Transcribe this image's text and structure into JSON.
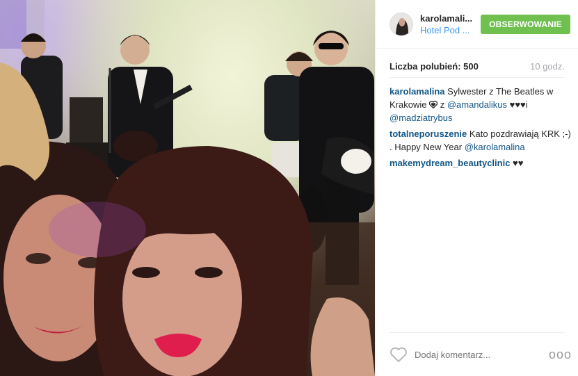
{
  "header": {
    "username": "karolamali...",
    "location": "Hotel Pod ...",
    "follow_label": "OBSERWOWANIE"
  },
  "stats": {
    "likes": "Liczba polubień: 500",
    "time": "10 godz."
  },
  "comments": [
    {
      "user": "karolamalina",
      "text_1": " Sylwester z The Beatles w Krakowie ",
      "text_2": " z ",
      "mention_1": "@amandalikus",
      "text_3": " ♥♥♥i ",
      "mention_2": "@madziatrybus"
    },
    {
      "user": "totalneporuszenie",
      "text_1": " Kato pozdrawiają KRK ;-) . Happy New Year ",
      "mention_1": "@karolamalina"
    },
    {
      "user": "makemydream_beautyclinic",
      "text_1": " ♥♥"
    }
  ],
  "footer": {
    "comment_placeholder": "Dodaj komentarz...",
    "more_label": "ooo"
  },
  "icons": {
    "heart": "heart-outline-icon",
    "heart_emoji": "black-heart-emoji-icon",
    "more": "more-options-icon"
  },
  "colors": {
    "follow_button": "#70c050",
    "link": "#125688",
    "location": "#3897f0"
  }
}
